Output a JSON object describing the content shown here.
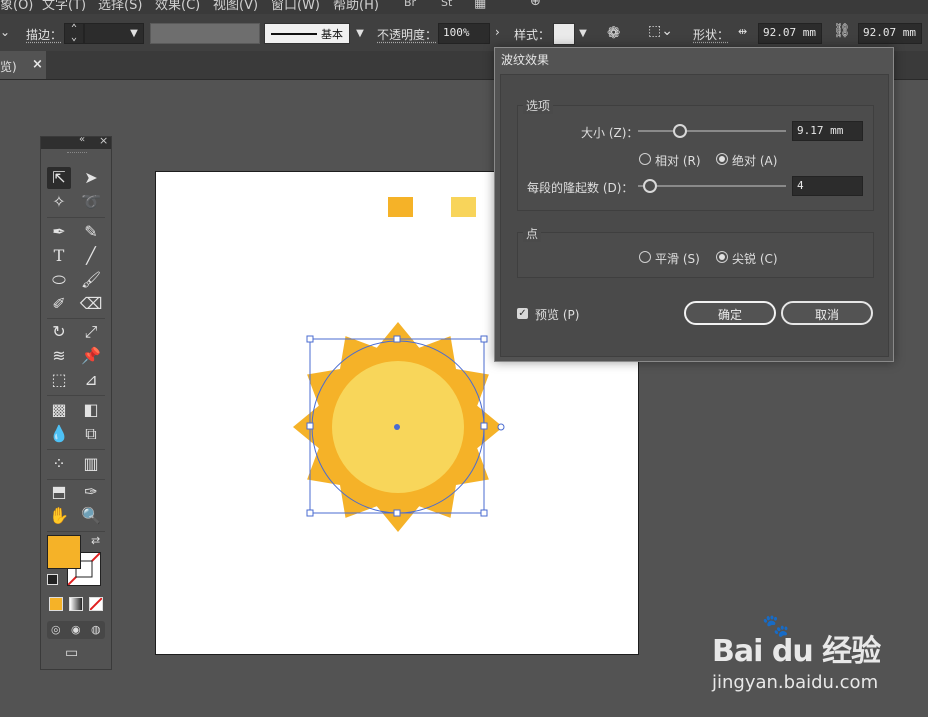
{
  "menubar": {
    "items": [
      "象(O)",
      "文字(T)",
      "选择(S)",
      "效果(C)",
      "视图(V)",
      "窗口(W)",
      "帮助(H)",
      "Br",
      "St"
    ]
  },
  "controlbar": {
    "stroke_label": "描边：",
    "brush_name": "基本",
    "opacity_label": "不透明度：",
    "opacity_value": "100%",
    "style_label": "样式：",
    "shape_label": "形状：",
    "width_value": "92.07 mm",
    "height_value": "92.07 mm"
  },
  "tabbar": {
    "doc_tab_label": "览)",
    "close_glyph": "×"
  },
  "toolbar": {
    "fill_color": "#f5b228",
    "stroke_color": "#ffffff"
  },
  "artwork": {
    "swatch_colors": [
      "#f5b228",
      "#f8d45a"
    ],
    "sun_outer_color": "#f5b228",
    "sun_inner_color": "#f8d65a",
    "selection_color": "#4a6bd0"
  },
  "dialog": {
    "title": "波纹效果",
    "options_group_label": "选项",
    "size_label": "大小 (Z)：",
    "size_value": "9.17 mm",
    "radio_relative": "相对 (R)",
    "radio_absolute": "绝对 (A)",
    "ridges_label": "每段的隆起数 (D)：",
    "ridges_value": "4",
    "points_group_label": "点",
    "radio_smooth": "平滑 (S)",
    "radio_corner": "尖锐 (C)",
    "preview_label": "预览 (P)",
    "ok_label": "确定",
    "cancel_label": "取消",
    "selected_unit_mode": "绝对",
    "selected_point_mode": "尖锐",
    "preview_checked": true
  },
  "watermark": {
    "brand": "Bai du 经验",
    "url": "jingyan.baidu.com"
  }
}
